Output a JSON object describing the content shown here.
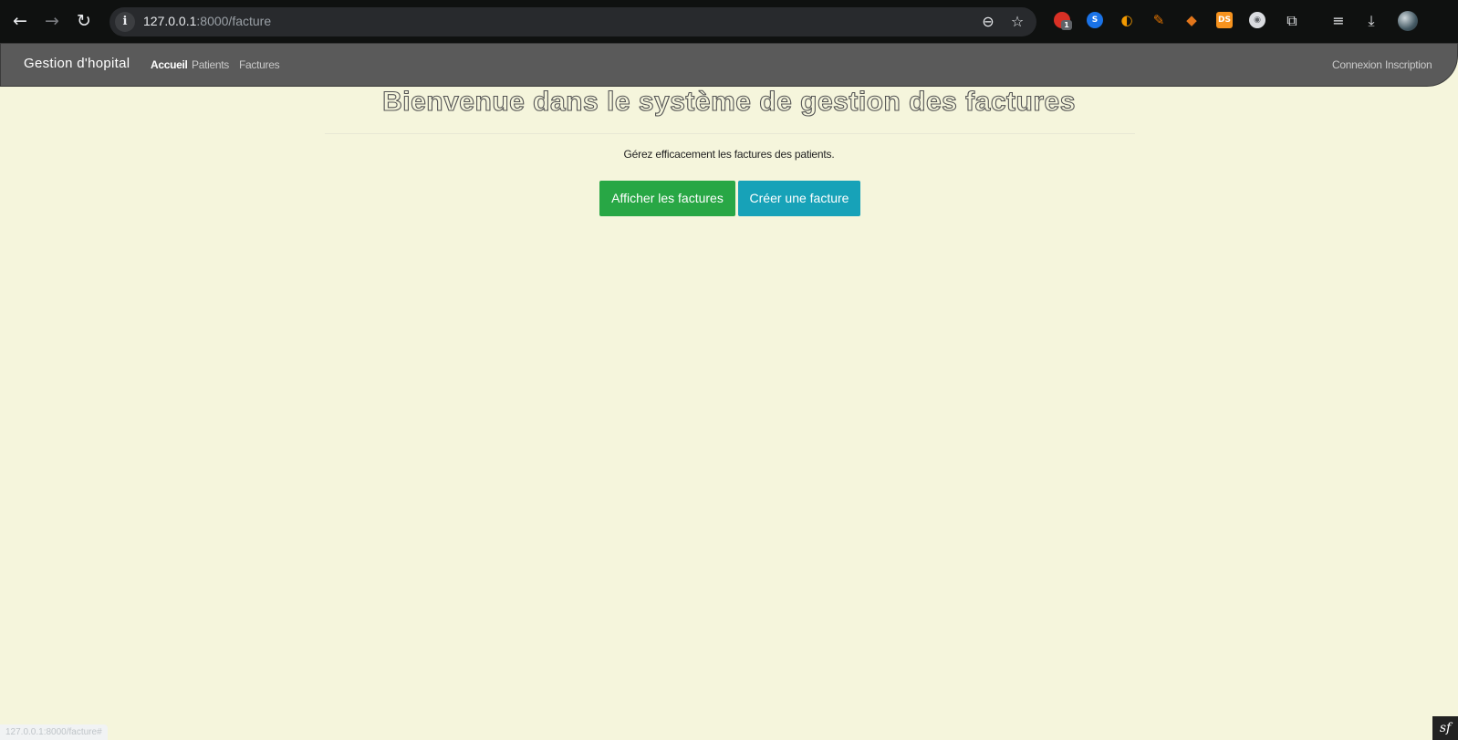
{
  "browser": {
    "url_host": "127.0.0.1",
    "url_path": ":8000/facture",
    "back_icon": "←",
    "forward_icon": "→",
    "reload_icon": "↻",
    "site_info_icon": "i",
    "zoom_icon": "⊖",
    "bookmark_icon": "☆",
    "extensions": [
      {
        "name": "extension-red",
        "glyph": "",
        "color": "#d93025",
        "badge": "1"
      },
      {
        "name": "extension-blue",
        "glyph": "S",
        "color": "#1a73e8"
      },
      {
        "name": "extension-orange-moon",
        "glyph": "◐",
        "color": "#f29900"
      },
      {
        "name": "extension-pen",
        "glyph": "✎",
        "color": "#e37400"
      },
      {
        "name": "extension-fox",
        "glyph": "◆",
        "color": "#e2761b"
      },
      {
        "name": "extension-ds",
        "glyph": "DS",
        "color": "#f7931e"
      },
      {
        "name": "extension-grey",
        "glyph": "◉",
        "color": "#9aa0a6"
      }
    ],
    "puzzle_icon": "⧉",
    "queue_icon": "≡",
    "download_icon": "⤓",
    "status_url": "127.0.0.1:8000/facture#"
  },
  "navbar": {
    "brand": "Gestion d'hopital",
    "links": [
      "Accueil",
      "Patients",
      "Factures"
    ],
    "right_links": [
      "Connexion",
      "Inscription"
    ]
  },
  "main": {
    "title": "Bienvenue dans le système de gestion des factures",
    "lead": "Gérez efficacement les factures des patients.",
    "btn_show": "Afficher les factures",
    "btn_create": "Créer une facture"
  },
  "colors": {
    "page_bg": "#f5f5dc",
    "navbar_bg": "#5a5a5a",
    "btn_show": "#28a745",
    "btn_create": "#17a2b8"
  },
  "debug_toolbar_glyph": "sf"
}
